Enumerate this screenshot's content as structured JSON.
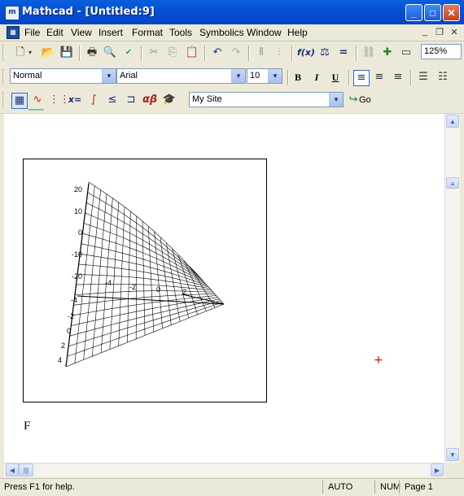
{
  "window": {
    "title": "Mathcad - [Untitled:9]",
    "app_icon": "m"
  },
  "menu": [
    "File",
    "Edit",
    "View",
    "Insert",
    "Format",
    "Tools",
    "Symbolics",
    "Window",
    "Help"
  ],
  "toolbar": {
    "zoom": "125%"
  },
  "format_bar": {
    "style": "Normal",
    "font": "Arial",
    "size": "10",
    "bold": "B",
    "italic": "I",
    "underline": "U"
  },
  "math_bar": {
    "site": "My Site",
    "go_label": "Go"
  },
  "document": {
    "plot": {
      "z_ticks_upper": [
        "20",
        "10",
        "0",
        "-10",
        "-20"
      ],
      "z_ticks_lower": [
        "-4",
        "-2",
        "0",
        "2",
        "4"
      ],
      "axis_ticks": [
        "-4",
        "-2",
        "0",
        "2"
      ]
    },
    "variable_label": "F"
  },
  "status": {
    "help": "Press F1 for help.",
    "mode": "AUTO",
    "num": "NUM",
    "page": "Page 1"
  },
  "colors": {
    "title_bar": "#0550d8",
    "cursor": "#e00000"
  }
}
